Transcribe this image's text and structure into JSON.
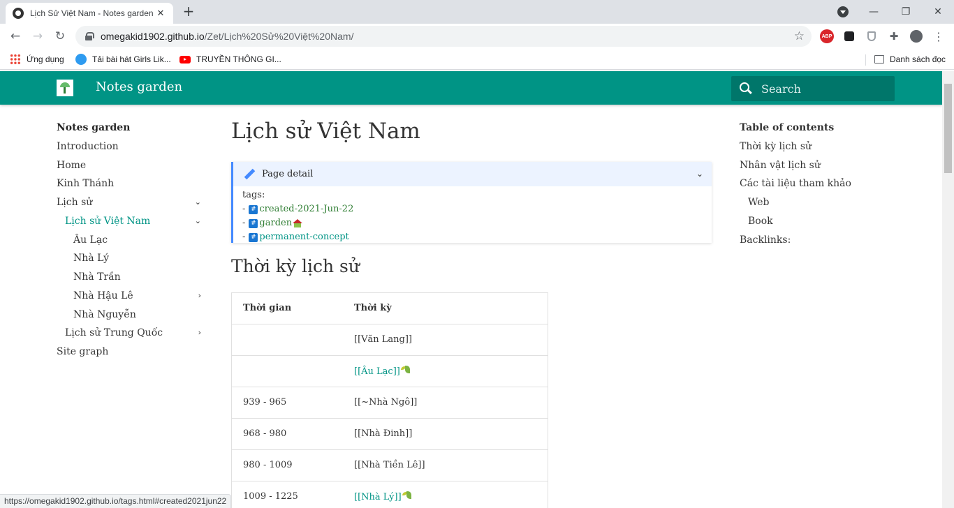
{
  "browser": {
    "tab_title": "Lịch Sử Việt Nam - Notes garden",
    "url_host": "omegakid1902.github.io",
    "url_path": "/Zet/Lịch%20Sử%20Việt%20Nam/",
    "bookmarks": [
      "Ứng dụng",
      "Tải bài hát Girls Lik...",
      "TRUYỀN THÔNG GI..."
    ],
    "reading_list": "Danh sách đọc",
    "status_url": "https://omegakid1902.github.io/tags.html#created2021jun22"
  },
  "header": {
    "site_title": "Notes garden",
    "search_placeholder": "Search"
  },
  "nav": {
    "title": "Notes garden",
    "items": [
      {
        "label": "Introduction"
      },
      {
        "label": "Home"
      },
      {
        "label": "Kinh Thánh"
      },
      {
        "label": "Lịch sử"
      },
      {
        "label": "Lịch sử Việt Nam"
      },
      {
        "label": "Âu Lạc"
      },
      {
        "label": "Nhà Lý"
      },
      {
        "label": "Nhà Trần"
      },
      {
        "label": "Nhà Hậu Lê"
      },
      {
        "label": "Nhà Nguyễn"
      },
      {
        "label": "Lịch sử Trung Quốc"
      },
      {
        "label": "Site graph"
      }
    ]
  },
  "page": {
    "title": "Lịch sử Việt Nam",
    "detail_title": "Page detail",
    "tags_label": "tags:",
    "tags": [
      "created-2021-Jun-22",
      "garden",
      "permanent-concept"
    ],
    "section_title": "Thời kỳ lịch sử"
  },
  "table": {
    "headers": [
      "Thời gian",
      "Thời kỳ"
    ],
    "rows": [
      {
        "time": "",
        "period": "[[Văn Lang]]"
      },
      {
        "time": "",
        "period": "[[Âu Lạc]]"
      },
      {
        "time": "939 - 965",
        "period": "[[~Nhà Ngô]]"
      },
      {
        "time": "968 - 980",
        "period": "[[Nhà Đinh]]"
      },
      {
        "time": "980 - 1009",
        "period": "[[Nhà Tiền Lê]]"
      },
      {
        "time": "1009 - 1225",
        "period": "[[Nhà Lý]]"
      }
    ]
  },
  "toc": {
    "title": "Table of contents",
    "items": [
      {
        "label": "Thời kỳ lịch sử"
      },
      {
        "label": "Nhân vật lịch sử"
      },
      {
        "label": "Các tài liệu tham khảo"
      },
      {
        "label": "Web"
      },
      {
        "label": "Book"
      },
      {
        "label": "Backlinks:"
      }
    ]
  },
  "colors": {
    "primary": "#009485",
    "admonition": "#448aff"
  }
}
